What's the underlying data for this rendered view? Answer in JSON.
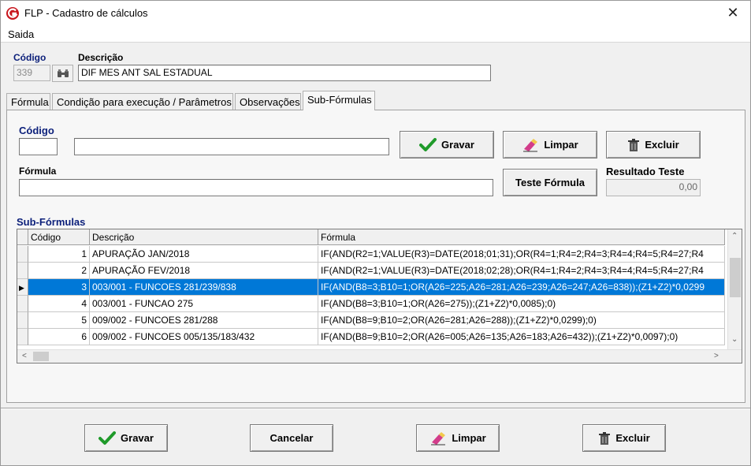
{
  "window": {
    "title": "FLP - Cadastro de cálculos",
    "close_icon": "close-icon"
  },
  "menu": {
    "items": [
      {
        "label": "Saida"
      }
    ]
  },
  "header": {
    "codigo_label": "Código",
    "codigo_value": "339",
    "descricao_label": "Descrição",
    "descricao_value": "DIF MES ANT SAL ESTADUAL"
  },
  "tabs": [
    {
      "label": "Fórmula"
    },
    {
      "label": "Condição para execução / Parâmetros"
    },
    {
      "label": "Observações"
    },
    {
      "label": "Sub-Fórmulas",
      "active": true
    }
  ],
  "subform": {
    "codigo_label": "Código",
    "codigo_value": "",
    "descricao_value": "",
    "formula_label": "Fórmula",
    "formula_value": "",
    "gravar": "Gravar",
    "limpar": "Limpar",
    "excluir": "Excluir",
    "teste": "Teste Fórmula",
    "resultado_label": "Resultado Teste",
    "resultado_value": "0,00"
  },
  "grid": {
    "title": "Sub-Fórmulas",
    "columns": [
      "Código",
      "Descrição",
      "Fórmula"
    ],
    "rows": [
      {
        "codigo": "1",
        "descricao": "APURAÇÃO JAN/2018",
        "formula": "IF(AND(R2=1;VALUE(R3)=DATE(2018;01;31);OR(R4=1;R4=2;R4=3;R4=4;R4=5;R4=27;R4"
      },
      {
        "codigo": "2",
        "descricao": "APURAÇÃO FEV/2018",
        "formula": "IF(AND(R2=1;VALUE(R3)=DATE(2018;02;28);OR(R4=1;R4=2;R4=3;R4=4;R4=5;R4=27;R4"
      },
      {
        "codigo": "3",
        "descricao": "003/001 - FUNCOES 281/239/838",
        "formula": "IF(AND(B8=3;B10=1;OR(A26=225;A26=281;A26=239;A26=247;A26=838));(Z1+Z2)*0,0299",
        "selected": true
      },
      {
        "codigo": "4",
        "descricao": "003/001 - FUNCAO 275",
        "formula": "IF(AND(B8=3;B10=1;OR(A26=275));(Z1+Z2)*0,0085);0)"
      },
      {
        "codigo": "5",
        "descricao": "009/002 - FUNCOES 281/288",
        "formula": "IF(AND(B8=9;B10=2;OR(A26=281;A26=288));(Z1+Z2)*0,0299);0)"
      },
      {
        "codigo": "6",
        "descricao": "009/002 - FUNCOES 005/135/183/432",
        "formula": "IF(AND(B8=9;B10=2;OR(A26=005;A26=135;A26=183;A26=432));(Z1+Z2)*0,0097);0)"
      }
    ]
  },
  "footer": {
    "gravar": "Gravar",
    "cancelar": "Cancelar",
    "limpar": "Limpar",
    "excluir": "Excluir"
  },
  "colors": {
    "label_blue": "#0b1f7a",
    "selection": "#0078d7",
    "check_green": "#1f9a2a",
    "app_icon_red": "#c8161d"
  }
}
